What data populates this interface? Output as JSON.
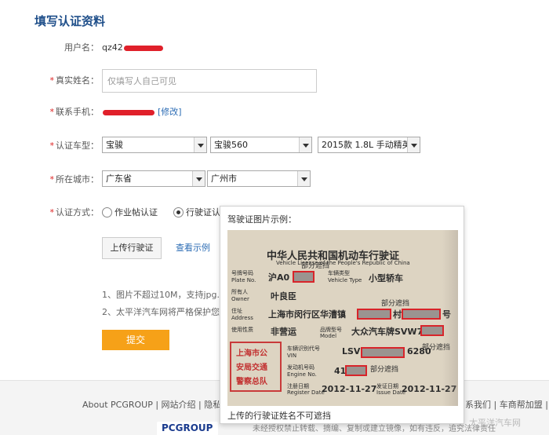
{
  "page": {
    "title": "填写认证资料"
  },
  "form": {
    "username": {
      "label": "用户名：",
      "value": "qz42"
    },
    "real_name": {
      "label": "真实姓名：",
      "placeholder": "仅填写人自己可见"
    },
    "phone": {
      "label": "联系手机：",
      "modify": "[修改]"
    },
    "car_model": {
      "label": "认证车型：",
      "brand": "宝骏",
      "series": "宝骏560",
      "trim": "2015款 1.8L 手动精英"
    },
    "city": {
      "label": "所在城市：",
      "province": "广东省",
      "city": "广州市"
    },
    "method": {
      "label": "认证方式：",
      "option1": "作业帖认证",
      "option2": "行驶证认",
      "selected": "option2"
    },
    "required_mark": "*"
  },
  "upload": {
    "button": "上传行驶证",
    "view_sample": "查看示例"
  },
  "notes": {
    "note1": "1、图片不超过10M，支持jpg.",
    "note2": "2、太平洋汽车网将严格保护您"
  },
  "submit": {
    "label": "提交"
  },
  "popup": {
    "title": "驾驶证图片示例：",
    "caption": "上传的行驶证姓名不可遮挡",
    "license": {
      "title": "中华人民共和国机动车行驶证",
      "subtitle": "Vehicle License of the People's Republic of China",
      "plate_prefix": "沪A0",
      "vehicle_type": "小型轿车",
      "owner": "叶良臣",
      "address": "上海市闵行区华漕镇",
      "address_suffix": "村",
      "address_end": "号",
      "use": "非营运",
      "model": "大众汽车牌SVW7",
      "vin_prefix": "LSV",
      "vin_suffix": "6280",
      "engine_prefix": "41",
      "date1": "2012-11-27",
      "date2": "2012-11-27",
      "mask_label": "部分遮挡",
      "label_plate": "号牌号码",
      "label_plate_en": "Plate No.",
      "label_vtype": "车辆类型",
      "label_vtype_en": "Vehicle Type",
      "label_owner": "所有人",
      "label_owner_en": "Owner",
      "label_address": "住址",
      "label_address_en": "Address",
      "label_use": "使用性质",
      "label_model": "品牌型号",
      "label_model_en": "Model",
      "label_vin": "车辆识别代号",
      "label_vin_en": "VIN",
      "label_engine": "发动机号码",
      "label_engine_en": "Engine No.",
      "label_reg": "注册日期",
      "label_reg_en": "Register Date",
      "label_issue": "发证日期",
      "label_issue_en": "Issue Date",
      "stamp_line1": "上海市公",
      "stamp_line2": "安局交通",
      "stamp_line3": "警察总队"
    }
  },
  "footer": {
    "links_left": "About PCGROUP | 网站介绍 | 隐私",
    "links_right": "系我们 | 车商帮加盟 |",
    "logo": "PCGROUP",
    "tail": "未经授权禁止转载、摘编、复制或建立镜像，如有违反，追究法律责任",
    "watermark": "太平洋汽车网"
  },
  "colors": {
    "accent_orange": "#f6a118",
    "link_blue": "#2d6db5",
    "title_blue": "#1f4f8a",
    "required_red": "#dd2222"
  }
}
